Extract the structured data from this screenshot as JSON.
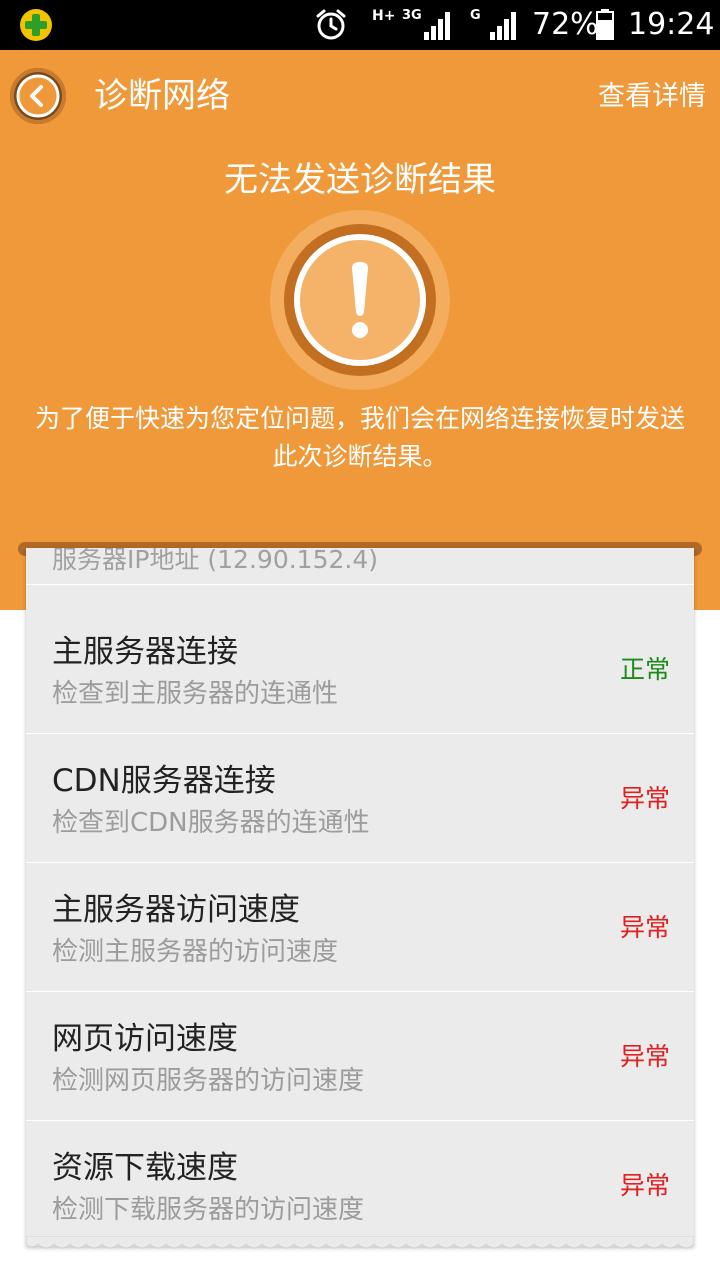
{
  "status_bar": {
    "app_icon": "plus-shield-icon",
    "alarm_icon": "alarm-clock-icon",
    "network_hplus": "H+",
    "network_3g": "3G",
    "network_g": "G",
    "battery_percent": "72%",
    "time": "19:24"
  },
  "header": {
    "back_icon": "chevron-left-icon",
    "title": "诊断网络",
    "details_link": "查看详情",
    "result_title": "无法发送诊断结果",
    "warning_icon": "exclamation-icon",
    "description": "为了便于快速为您定位问题，我们会在网络连接恢复时发送此次诊断结果。"
  },
  "list": {
    "partial_row": "服务器IP地址 (12.90.152.4)",
    "items": [
      {
        "title": "主服务器连接",
        "subtitle": "检查到主服务器的连通性",
        "status": "正常",
        "status_color": "#1a8a1a"
      },
      {
        "title": "CDN服务器连接",
        "subtitle": "检查到CDN服务器的连通性",
        "status": "异常",
        "status_color": "#e02020"
      },
      {
        "title": "主服务器访问速度",
        "subtitle": "检测主服务器的访问速度",
        "status": "异常",
        "status_color": "#e02020"
      },
      {
        "title": "网页访问速度",
        "subtitle": "检测网页服务器的访问速度",
        "status": "异常",
        "status_color": "#e02020"
      },
      {
        "title": "资源下载速度",
        "subtitle": "检测下载服务器的访问速度",
        "status": "异常",
        "status_color": "#e02020"
      }
    ]
  },
  "colors": {
    "header_bg": "#f0993a",
    "normal": "#1a8a1a",
    "abnormal": "#e02020"
  }
}
